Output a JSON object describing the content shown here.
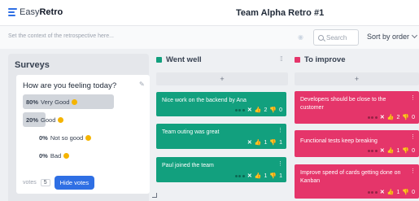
{
  "app": {
    "brand_light": "Easy",
    "brand_bold": "Retro",
    "board_title": "Team Alpha Retro #1"
  },
  "context": {
    "placeholder": "Set the context of the retrospective here..."
  },
  "search": {
    "placeholder": "Search"
  },
  "sort": {
    "label": "Sort by order"
  },
  "surveys": {
    "title": "Surveys",
    "question": "How are you feeling today?",
    "options": [
      {
        "pct": "80%",
        "label": "Very Good",
        "fraction": 0.8
      },
      {
        "pct": "20%",
        "label": "Good",
        "fraction": 0.2
      },
      {
        "pct": "0%",
        "label": "Not so good",
        "fraction": 0
      },
      {
        "pct": "0%",
        "label": "Bad",
        "fraction": 0
      }
    ],
    "votes_label": "votes",
    "votes_count": "5",
    "hide_votes": "Hide votes"
  },
  "columns": {
    "went_well": {
      "title": "Went well",
      "color": "#12a07e",
      "add": "+",
      "cards": [
        {
          "text": "Nice work on the backend by Ana",
          "likes": "2",
          "dislikes": "0"
        },
        {
          "text": "Team outing was great",
          "likes": "1",
          "dislikes": "1"
        },
        {
          "text": "Paul joined the team",
          "likes": "1",
          "dislikes": "1"
        }
      ]
    },
    "to_improve": {
      "title": "To improve",
      "color": "#e5356a",
      "add": "+",
      "cards": [
        {
          "text": "Developers should be close to the customer",
          "likes": "2",
          "dislikes": "0"
        },
        {
          "text": "Functional tests keep breaking",
          "likes": "1",
          "dislikes": "0"
        },
        {
          "text": "Improve speed of cards getting done on Kanban",
          "likes": "1",
          "dislikes": "0"
        }
      ]
    }
  },
  "icons": {
    "x": "✕",
    "thumb_up": "👍",
    "thumb_down": "👎",
    "menu": "⋮",
    "grip": "⁞⁞",
    "pencil": "✎",
    "eye": "◉"
  }
}
